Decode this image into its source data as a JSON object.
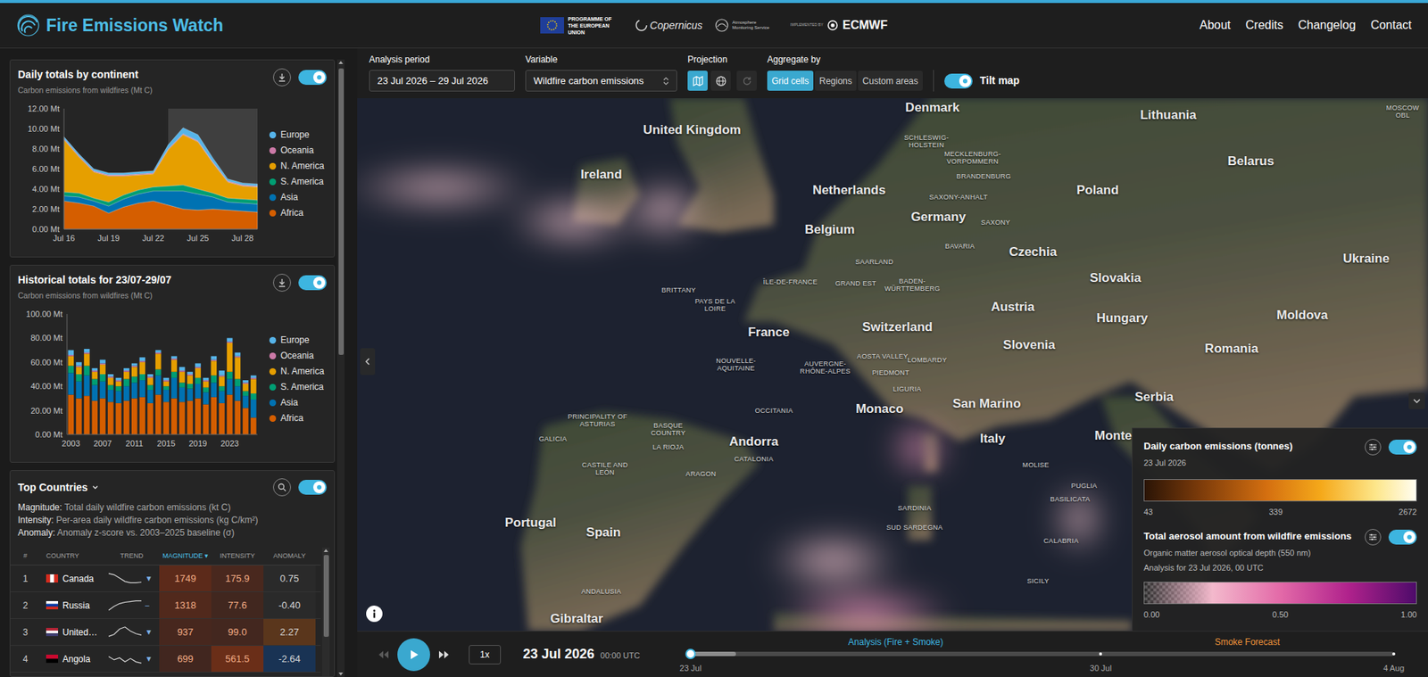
{
  "header": {
    "title": "Fire Emissions Watch",
    "partners": {
      "eu": "PROGRAMME OF THE EUROPEAN UNION",
      "copernicus": "Copernicus",
      "cams": "Atmosphere Monitoring Service",
      "implemented": "IMPLEMENTED BY",
      "ecmwf": "ECMWF"
    },
    "nav": [
      "About",
      "Credits",
      "Changelog",
      "Contact"
    ]
  },
  "charts": {
    "daily": {
      "title": "Daily totals by continent",
      "subtitle": "Carbon emissions from wildfires (Mt C)",
      "enabled": true,
      "y_max": 12,
      "y_ticks": [
        {
          "label": "0.00 Mt",
          "value": 0
        },
        {
          "label": "2.00 Mt",
          "value": 2
        },
        {
          "label": "4.00 Mt",
          "value": 4
        },
        {
          "label": "6.00 Mt",
          "value": 6
        },
        {
          "label": "8.00 Mt",
          "value": 8
        },
        {
          "label": "10.00 Mt",
          "value": 10
        },
        {
          "label": "12.00 Mt",
          "value": 12
        }
      ],
      "x_ticks": [
        {
          "label": "Jul 16",
          "index": 0
        },
        {
          "label": "Jul 19",
          "index": 3
        },
        {
          "label": "Jul 22",
          "index": 6
        },
        {
          "label": "Jul 25",
          "index": 9
        },
        {
          "label": "Jul 28",
          "index": 12
        }
      ],
      "highlight": {
        "from_index": 7,
        "to_index": 13
      },
      "series": [
        {
          "name": "Europe",
          "color": "#56b4e9",
          "values": [
            0.2,
            0.2,
            0.2,
            0.2,
            0.2,
            0.2,
            0.2,
            0.4,
            0.6,
            0.6,
            0.4,
            0.2,
            0.2,
            0.2
          ]
        },
        {
          "name": "Oceania",
          "color": "#cc79a7",
          "values": [
            0.1,
            0.1,
            0.1,
            0.1,
            0.1,
            0.1,
            0.1,
            0.1,
            0.1,
            0.1,
            0.1,
            0.1,
            0.1,
            0.1
          ]
        },
        {
          "name": "N. America",
          "color": "#e69f00",
          "values": [
            5.2,
            3.6,
            2.6,
            2.6,
            1.9,
            1.5,
            1.3,
            3.6,
            5.0,
            4.7,
            3.0,
            1.6,
            1.3,
            1.3
          ]
        },
        {
          "name": "S. America",
          "color": "#009e73",
          "values": [
            0.4,
            0.4,
            0.3,
            0.4,
            0.4,
            0.4,
            0.4,
            0.5,
            0.6,
            0.5,
            0.4,
            0.4,
            0.4,
            0.4
          ]
        },
        {
          "name": "Asia",
          "color": "#0072b2",
          "values": [
            0.5,
            0.6,
            0.5,
            0.7,
            0.8,
            0.9,
            1.0,
            1.4,
            1.8,
            1.6,
            1.2,
            0.8,
            0.8,
            0.8
          ]
        },
        {
          "name": "Africa",
          "color": "#d55e00",
          "values": [
            2.8,
            2.6,
            2.3,
            1.6,
            2.2,
            2.6,
            2.8,
            2.4,
            2.0,
            1.9,
            2.0,
            1.9,
            1.8,
            1.7
          ]
        }
      ]
    },
    "historical": {
      "title": "Historical totals for 23/07-29/07",
      "subtitle": "Carbon emissions from wildfires (Mt C)",
      "enabled": true,
      "y_max": 100,
      "y_ticks": [
        {
          "label": "0.00 Mt",
          "value": 0
        },
        {
          "label": "20.00 Mt",
          "value": 20
        },
        {
          "label": "40.00 Mt",
          "value": 40
        },
        {
          "label": "60.00 Mt",
          "value": 60
        },
        {
          "label": "80.00 Mt",
          "value": 80
        },
        {
          "label": "100.00 Mt",
          "value": 100
        }
      ],
      "x_ticks": [
        {
          "label": "2003",
          "index": 0
        },
        {
          "label": "2007",
          "index": 4
        },
        {
          "label": "2011",
          "index": 8
        },
        {
          "label": "2015",
          "index": 12
        },
        {
          "label": "2019",
          "index": 16
        },
        {
          "label": "2023",
          "index": 20
        }
      ],
      "series": [
        {
          "name": "Europe",
          "color": "#56b4e9",
          "values": [
            4,
            3,
            3,
            2,
            3,
            2,
            2,
            2,
            2,
            3,
            2,
            2,
            2,
            2,
            3,
            2,
            3,
            2,
            3,
            4,
            3,
            3,
            2,
            2
          ]
        },
        {
          "name": "Oceania",
          "color": "#cc79a7",
          "values": [
            1,
            1,
            1,
            1,
            1,
            1,
            1,
            1,
            1,
            1,
            1,
            1,
            1,
            1,
            1,
            1,
            1,
            1,
            1,
            1,
            1,
            1,
            1,
            1
          ]
        },
        {
          "name": "N. America",
          "color": "#e69f00",
          "values": [
            8,
            6,
            10,
            6,
            8,
            6,
            4,
            6,
            8,
            10,
            6,
            13,
            4,
            10,
            9,
            7,
            8,
            5,
            12,
            8,
            24,
            18,
            6,
            12
          ]
        },
        {
          "name": "S. America",
          "color": "#009e73",
          "values": [
            6,
            6,
            8,
            5,
            6,
            4,
            4,
            6,
            5,
            5,
            4,
            5,
            3,
            5,
            4,
            4,
            5,
            4,
            6,
            4,
            6,
            6,
            4,
            5
          ]
        },
        {
          "name": "Asia",
          "color": "#0072b2",
          "values": [
            18,
            14,
            17,
            13,
            14,
            10,
            10,
            12,
            13,
            14,
            11,
            16,
            10,
            17,
            12,
            10,
            12,
            10,
            12,
            10,
            13,
            12,
            10,
            15
          ]
        },
        {
          "name": "Africa",
          "color": "#d55e00",
          "values": [
            33,
            30,
            32,
            28,
            30,
            27,
            26,
            28,
            30,
            31,
            26,
            33,
            27,
            30,
            27,
            28,
            30,
            25,
            31,
            26,
            33,
            28,
            22,
            14
          ]
        }
      ]
    }
  },
  "top_countries": {
    "title": "Top Countries",
    "enabled": true,
    "descriptions": [
      {
        "term": "Magnitude:",
        "text": "Total daily wildfire carbon emissions (kt C)"
      },
      {
        "term": "Intensity:",
        "text": "Per-area daily wildfire carbon emissions (kg C/km²)"
      },
      {
        "term": "Anomaly:",
        "text": "Anomaly z-score vs. 2003–2025 baseline (σ)"
      }
    ],
    "columns": [
      {
        "label": "#",
        "sorted": false
      },
      {
        "label": "COUNTRY",
        "sorted": false
      },
      {
        "label": "TREND",
        "sorted": false
      },
      {
        "label": "MAGNITUDE",
        "sorted": true,
        "arrow": "▾"
      },
      {
        "label": "INTENSITY",
        "sorted": false
      },
      {
        "label": "ANOMALY",
        "sorted": false
      }
    ],
    "rows": [
      {
        "rank": "1",
        "country": "Canada",
        "flag_kind": "vertical",
        "flag_colors": [
          "#d52b1e",
          "#ffffff",
          "#d52b1e"
        ],
        "trend": [
          0.9,
          0.8,
          0.55,
          0.3,
          0.2,
          0.2,
          0.25
        ],
        "trend_icon": "▼",
        "magnitude": "1749",
        "magnitude_level": 1.0,
        "intensity": "175.9",
        "intensity_level": 0.31,
        "anomaly": "0.75",
        "anomaly_sigma": 0.75
      },
      {
        "rank": "2",
        "country": "Russia",
        "flag_kind": "horizontal",
        "flag_colors": [
          "#ffffff",
          "#0039a6",
          "#d52b1e"
        ],
        "trend": [
          0.15,
          0.45,
          0.65,
          0.75,
          0.8,
          0.85,
          0.85
        ],
        "trend_icon": "–",
        "magnitude": "1318",
        "magnitude_level": 0.75,
        "intensity": "77.6",
        "intensity_level": 0.14,
        "anomaly": "-0.40",
        "anomaly_sigma": -0.4
      },
      {
        "rank": "3",
        "country": "United…",
        "flag_kind": "horizontal",
        "flag_colors": [
          "#b22234",
          "#ffffff",
          "#3c3b6e"
        ],
        "trend": [
          0.2,
          0.35,
          0.75,
          0.9,
          0.6,
          0.4,
          0.3
        ],
        "trend_icon": "▼",
        "magnitude": "937",
        "magnitude_level": 0.54,
        "intensity": "99.0",
        "intensity_level": 0.18,
        "anomaly": "2.27",
        "anomaly_sigma": 2.27
      },
      {
        "rank": "4",
        "country": "Angola",
        "flag_kind": "horizontal",
        "flag_colors": [
          "#cc092f",
          "#000000"
        ],
        "trend": [
          0.7,
          0.45,
          0.6,
          0.3,
          0.55,
          0.3,
          0.2
        ],
        "trend_icon": "▼",
        "magnitude": "699",
        "magnitude_level": 0.4,
        "intensity": "561.5",
        "intensity_level": 1.0,
        "anomaly": "-2.64",
        "anomaly_sigma": -2.64
      }
    ]
  },
  "toolbar": {
    "period": {
      "label": "Analysis period",
      "value": "23 Jul 2026 – 29 Jul 2026"
    },
    "variable": {
      "label": "Variable",
      "value": "Wildfire carbon emissions"
    },
    "projection": {
      "label": "Projection",
      "options": [
        {
          "kind": "flat",
          "selected": true
        },
        {
          "kind": "globe",
          "selected": false
        }
      ],
      "reset_disabled": true
    },
    "aggregate": {
      "label": "Aggregate by",
      "options": [
        {
          "label": "Grid cells",
          "selected": true
        },
        {
          "label": "Regions",
          "selected": false
        },
        {
          "label": "Custom areas",
          "selected": false
        }
      ]
    },
    "tilt": {
      "label": "Tilt map",
      "on": true
    }
  },
  "map": {
    "labels": [
      {
        "text": "Denmark",
        "kind": "country"
      },
      {
        "text": "Lithuania",
        "kind": "country"
      },
      {
        "text": "MOSCOW OBL",
        "kind": "region"
      },
      {
        "text": "United Kingdom",
        "kind": "country"
      },
      {
        "text": "Ireland",
        "kind": "country"
      },
      {
        "text": "Netherlands",
        "kind": "country"
      },
      {
        "text": "Germany",
        "kind": "country"
      },
      {
        "text": "Poland",
        "kind": "country"
      },
      {
        "text": "Belarus",
        "kind": "country"
      },
      {
        "text": "Belgium",
        "kind": "country"
      },
      {
        "text": "Czechia",
        "kind": "country"
      },
      {
        "text": "Ukraine",
        "kind": "country"
      },
      {
        "text": "Slovakia",
        "kind": "country"
      },
      {
        "text": "France",
        "kind": "country"
      },
      {
        "text": "Switzerland",
        "kind": "country"
      },
      {
        "text": "Austria",
        "kind": "country"
      },
      {
        "text": "Hungary",
        "kind": "country"
      },
      {
        "text": "Moldova",
        "kind": "country"
      },
      {
        "text": "Slovenia",
        "kind": "country"
      },
      {
        "text": "Romania",
        "kind": "country"
      },
      {
        "text": "San Marino",
        "kind": "country"
      },
      {
        "text": "Monaco",
        "kind": "country"
      },
      {
        "text": "Serbia",
        "kind": "country"
      },
      {
        "text": "Andorra",
        "kind": "country"
      },
      {
        "text": "Italy",
        "kind": "country"
      },
      {
        "text": "Portugal",
        "kind": "country"
      },
      {
        "text": "Spain",
        "kind": "country"
      },
      {
        "text": "Gibraltar",
        "kind": "country"
      },
      {
        "text": "Monte",
        "kind": "country"
      },
      {
        "text": "SCHLESWIG-HOLSTEIN",
        "kind": "region"
      },
      {
        "text": "MECKLENBURG-VORPOMMERN",
        "kind": "region"
      },
      {
        "text": "BRANDENBURG",
        "kind": "region"
      },
      {
        "text": "SAXONY-ANHALT",
        "kind": "region"
      },
      {
        "text": "SAXONY",
        "kind": "region"
      },
      {
        "text": "BAVARIA",
        "kind": "region"
      },
      {
        "text": "SAARLAND",
        "kind": "region"
      },
      {
        "text": "GRAND EST",
        "kind": "region"
      },
      {
        "text": "BADEN-WÜRTTEMBERG",
        "kind": "region"
      },
      {
        "text": "ÎLE-DE-FRANCE",
        "kind": "region"
      },
      {
        "text": "BRITTANY",
        "kind": "region"
      },
      {
        "text": "PAYS DE LA LOIRE",
        "kind": "region"
      },
      {
        "text": "NOUVELLE-AQUITAINE",
        "kind": "region"
      },
      {
        "text": "AUVERGNE-RHÔNE-ALPES",
        "kind": "region"
      },
      {
        "text": "AOSTA VALLEY",
        "kind": "region"
      },
      {
        "text": "LOMBARDY",
        "kind": "region"
      },
      {
        "text": "PIEDMONT",
        "kind": "region"
      },
      {
        "text": "LIGURIA",
        "kind": "region"
      },
      {
        "text": "OCCITANIA",
        "kind": "region"
      },
      {
        "text": "PRINCIPALITY OF ASTURIAS",
        "kind": "region"
      },
      {
        "text": "GALICIA",
        "kind": "region"
      },
      {
        "text": "BASQUE COUNTRY",
        "kind": "region"
      },
      {
        "text": "LA RIOJA",
        "kind": "region"
      },
      {
        "text": "CATALONIA",
        "kind": "region"
      },
      {
        "text": "ARAGON",
        "kind": "region"
      },
      {
        "text": "CASTILE AND LEÓN",
        "kind": "region"
      },
      {
        "text": "ANDALUSIA",
        "kind": "region"
      },
      {
        "text": "SARDINIA",
        "kind": "region"
      },
      {
        "text": "SUD SARDEGNA",
        "kind": "region"
      },
      {
        "text": "MOLISE",
        "kind": "region"
      },
      {
        "text": "PUGLIA",
        "kind": "region"
      },
      {
        "text": "BASILICATA",
        "kind": "region"
      },
      {
        "text": "CALABRIA",
        "kind": "region"
      },
      {
        "text": "SICILY",
        "kind": "region"
      }
    ]
  },
  "legend": {
    "emissions": {
      "title": "Daily carbon emissions (tonnes)",
      "date": "23 Jul 2026",
      "on": true,
      "ticks": [
        "43",
        "339",
        "2672"
      ]
    },
    "aerosol": {
      "title": "Total aerosol amount from wildfire emissions",
      "subtitle": "Organic matter aerosol optical depth (550 nm)",
      "date": "Analysis for 23 Jul 2026, 00 UTC",
      "on": true,
      "ticks": [
        "0.00",
        "0.50",
        "1.00"
      ]
    }
  },
  "timeline": {
    "rewind_disabled": true,
    "playing": false,
    "speed": "1x",
    "date": "23 Jul 2026",
    "time": "00:00 UTC",
    "segments": [
      {
        "label": "Analysis (Fire + Smoke)",
        "color": "#3db5e0",
        "from_day": 0,
        "to_day": 7
      },
      {
        "label": "Smoke Forecast",
        "color": "#f0943a",
        "from_day": 7,
        "to_day": 12
      }
    ],
    "ticks": [
      {
        "label": "23 Jul",
        "day": 0
      },
      {
        "label": "30 Jul",
        "day": 7
      },
      {
        "label": "4 Aug",
        "day": 12
      }
    ],
    "total_days": 12,
    "level": 0,
    "loaded_level": 0.065
  }
}
